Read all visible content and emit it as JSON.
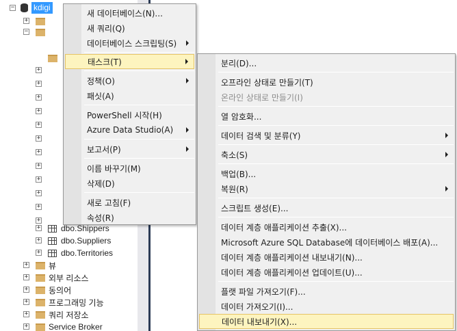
{
  "tree": {
    "database": "kdigi",
    "tables": [
      "dbo.Shippers",
      "dbo.Suppliers",
      "dbo.Territories"
    ],
    "folders": [
      "뷰",
      "외부 리소스",
      "동의어",
      "프로그래밍 기능",
      "쿼리 저장소",
      "Service Broker"
    ]
  },
  "context_menu": {
    "items": [
      {
        "label": "새 데이터베이스(N)...",
        "submenu": false
      },
      {
        "label": "새 쿼리(Q)",
        "submenu": false
      },
      {
        "label": "데이터베이스 스크립팅(S)",
        "submenu": true
      },
      {
        "label": "태스크(T)",
        "submenu": true,
        "selected": true
      },
      {
        "label": "정책(O)",
        "submenu": true
      },
      {
        "label": "패싯(A)",
        "submenu": false
      },
      {
        "label": "PowerShell 시작(H)",
        "submenu": false
      },
      {
        "label": "Azure Data Studio(A)",
        "submenu": true
      },
      {
        "label": "보고서(P)",
        "submenu": true
      },
      {
        "label": "이름 바꾸기(M)",
        "submenu": false
      },
      {
        "label": "삭제(D)",
        "submenu": false
      },
      {
        "label": "새로 고침(F)",
        "submenu": false
      },
      {
        "label": "속성(R)",
        "submenu": false
      }
    ]
  },
  "tasks_menu": {
    "items": [
      {
        "label": "분리(D)...",
        "submenu": false
      },
      {
        "label": "오프라인 상태로 만들기(T)",
        "submenu": false
      },
      {
        "label": "온라인 상태로 만들기(I)",
        "submenu": false,
        "disabled": true
      },
      {
        "label": "열 암호화...",
        "submenu": false
      },
      {
        "label": "데이터 검색 및 분류(Y)",
        "submenu": true
      },
      {
        "label": "축소(S)",
        "submenu": true
      },
      {
        "label": "백업(B)...",
        "submenu": false
      },
      {
        "label": "복원(R)",
        "submenu": true
      },
      {
        "label": "스크립트 생성(E)...",
        "submenu": false
      },
      {
        "label": "데이터 계층 애플리케이션 추출(X)...",
        "submenu": false
      },
      {
        "label": "Microsoft Azure SQL Database에 데이터베이스 배포(A)...",
        "submenu": false
      },
      {
        "label": "데이터 계층 애플리케이션 내보내기(N)...",
        "submenu": false
      },
      {
        "label": "데이터 계층 애플리케이션 업데이트(U)...",
        "submenu": false
      },
      {
        "label": "플랫 파일 가져오기(F)...",
        "submenu": false
      },
      {
        "label": "데이터 가져오기(I)...",
        "submenu": false
      },
      {
        "label": "데이터 내보내기(X)...",
        "submenu": false,
        "highlighted": true
      }
    ]
  },
  "colors": {
    "selection": "#3399ff",
    "menu_background": "#f0f0f0",
    "hover_highlight": "#fdf4bf",
    "panel_divider": "#2b3a55"
  }
}
